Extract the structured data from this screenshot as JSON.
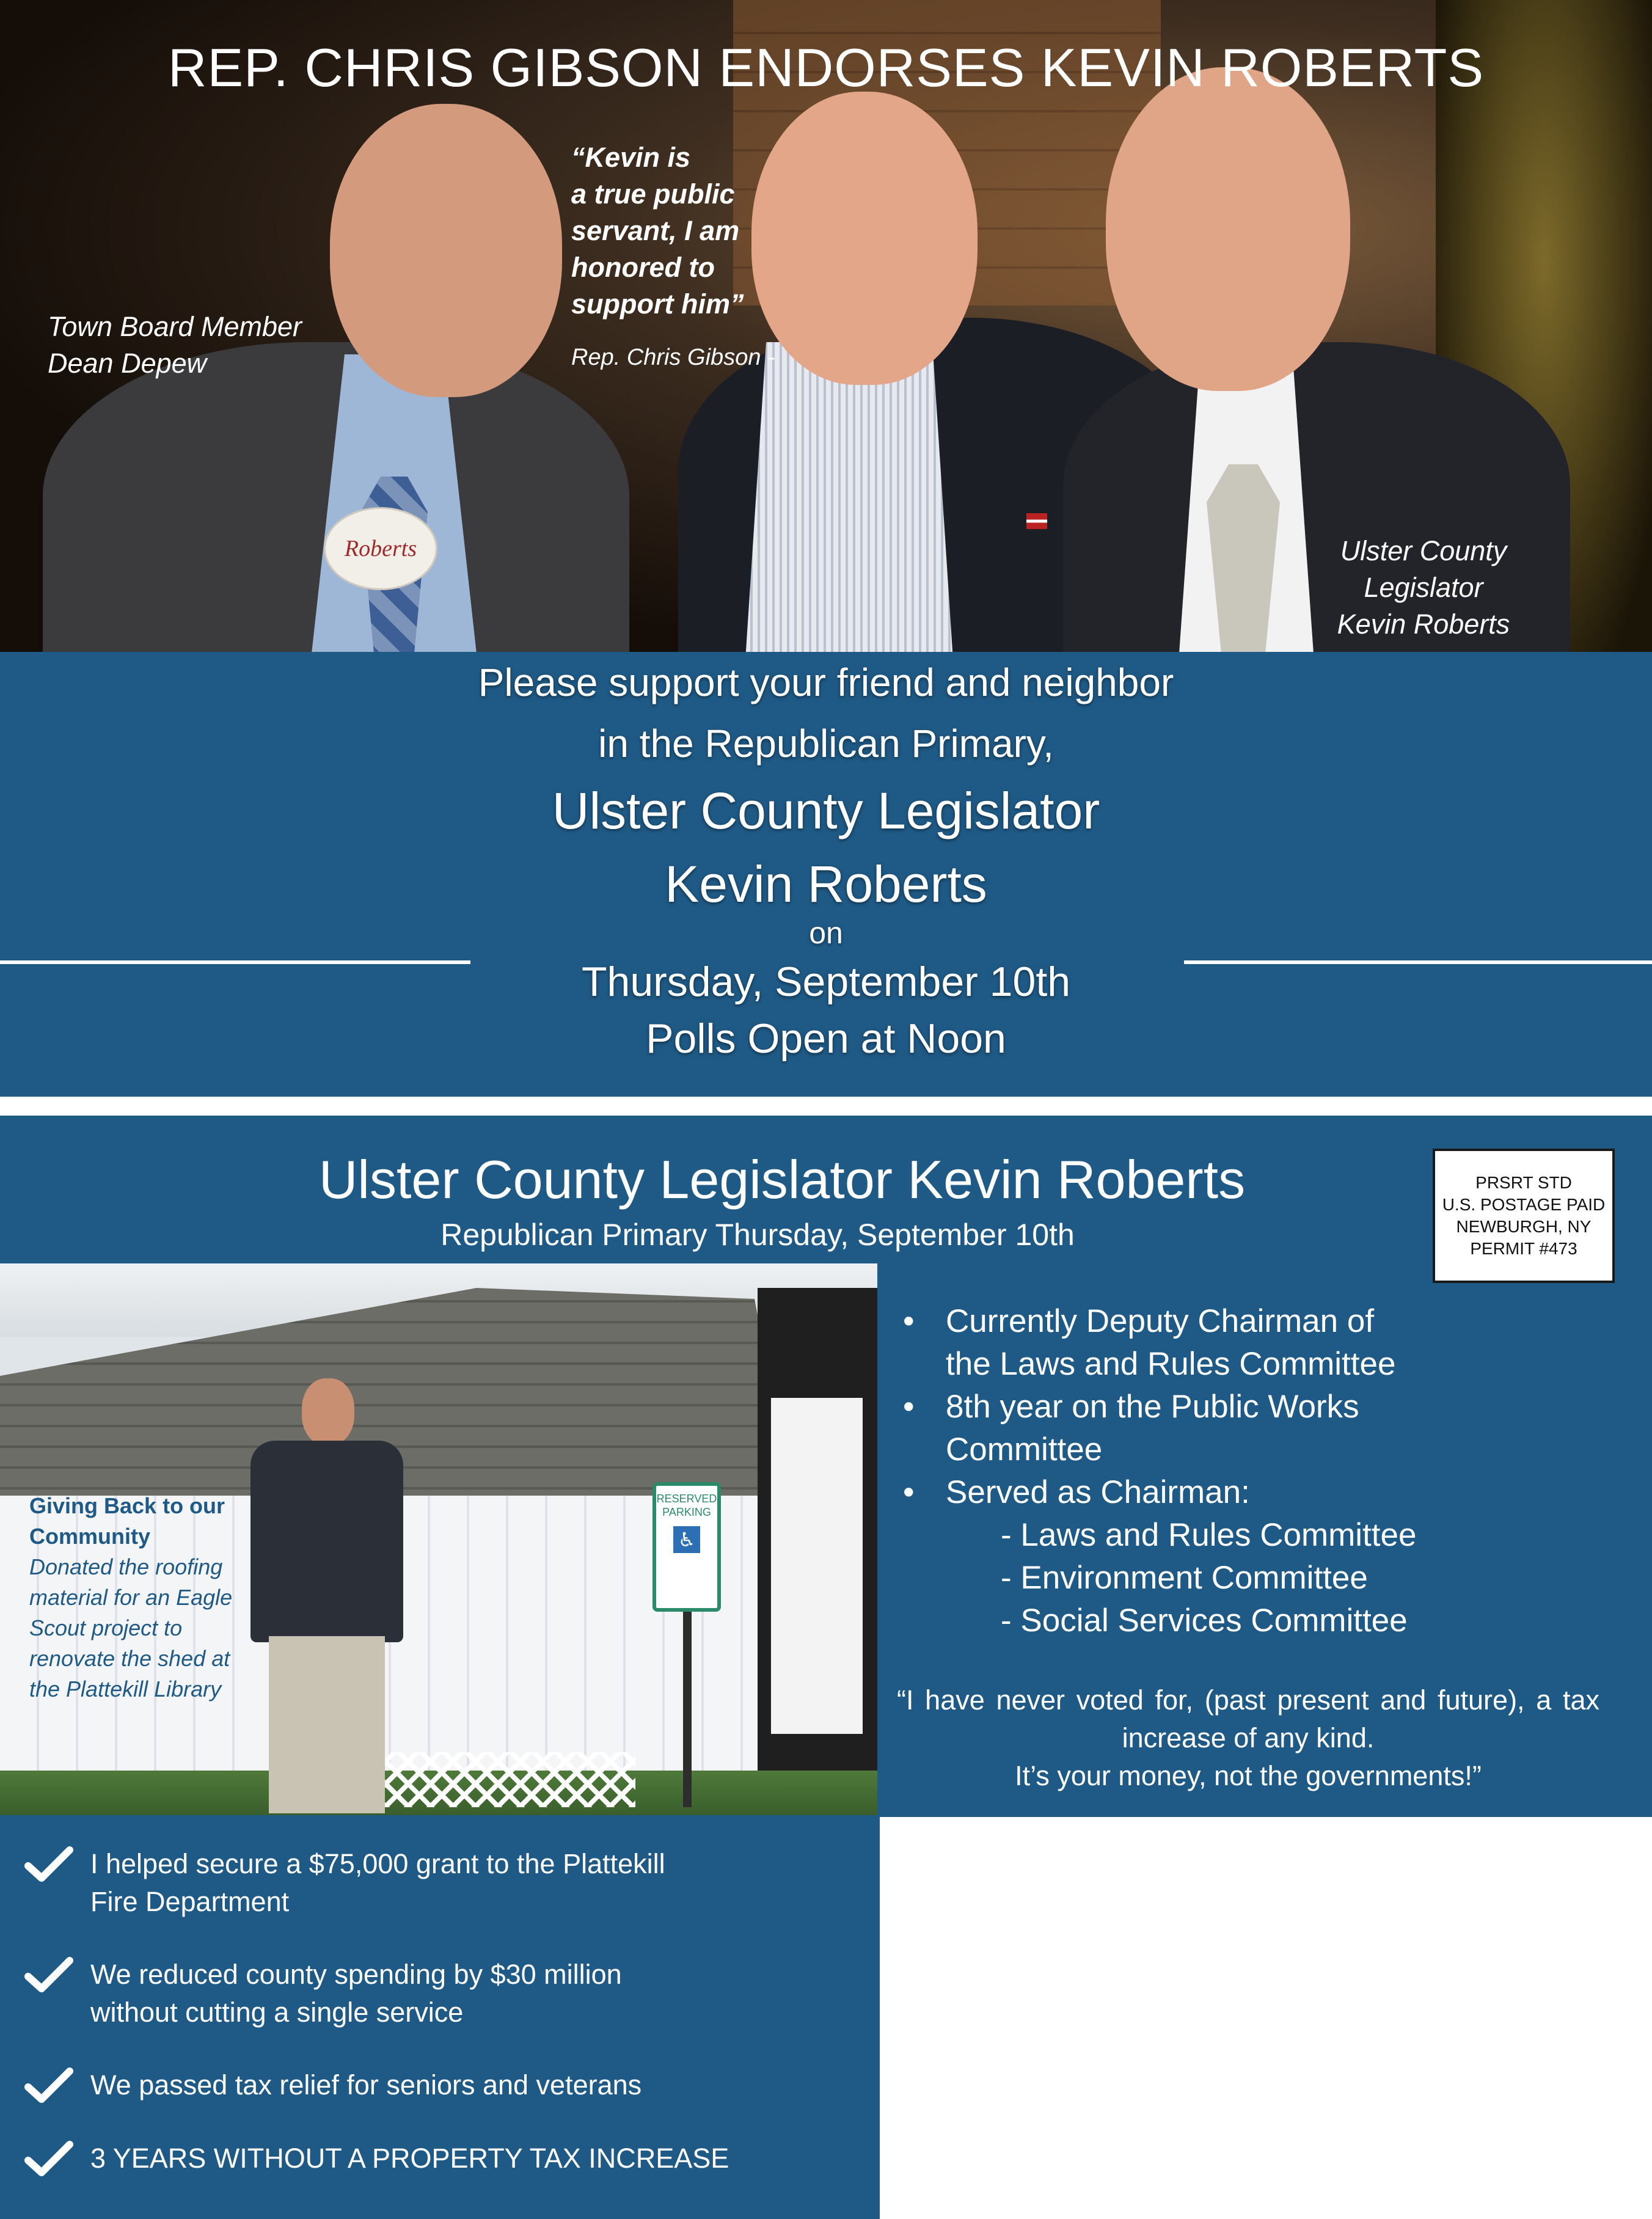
{
  "header": {
    "headline": "REP. CHRIS GIBSON ENDORSES KEVIN ROBERTS",
    "quote_lines": [
      "“Kevin is",
      "a true public",
      "servant, I am",
      "honored to",
      "support him”"
    ],
    "quote_attribution": "Rep. Chris Gibson -",
    "left_caption": [
      "Town Board Member",
      "Dean Depew"
    ],
    "right_caption": [
      "Ulster County",
      "Legislator",
      "Kevin Roberts"
    ],
    "button_text": "Roberts"
  },
  "appeal": {
    "line1": "Please support your friend and neighbor",
    "line2": "in the Republican Primary,",
    "line3": "Ulster County Legislator",
    "line4": "Kevin Roberts",
    "line5": "on",
    "line6": "Thursday, September 10th",
    "line7": "Polls Open at Noon"
  },
  "mailer": {
    "title": "Ulster County Legislator Kevin Roberts",
    "subtitle": "Republican Primary Thursday, September 10th",
    "postage": [
      "PRSRT STD",
      "U.S. POSTAGE PAID",
      "NEWBURGH, NY",
      "PERMIT #473"
    ]
  },
  "photo_caption": {
    "heading": [
      "Giving Back to our",
      "Community"
    ],
    "body": [
      "Donated the roofing",
      "material for an Eagle",
      "Scout project to",
      "renovate the shed at",
      "the Plattekill Library"
    ],
    "sign_text": [
      "RESERVED",
      "PARKING"
    ]
  },
  "record": {
    "bullets": [
      {
        "text": "Currently Deputy Chairman of",
        "cont": "the Laws and Rules Committee"
      },
      {
        "text": "8th year on the Public Works",
        "cont": "Committee"
      },
      {
        "text": "Served as Chairman:",
        "cont": ""
      }
    ],
    "chair_list": [
      "- Laws and Rules Committee",
      "- Environment Committee",
      "- Social Services Committee"
    ],
    "quote_line1": "“I have never voted for, (past present and future), a tax increase of any kind.",
    "quote_line2": "It’s your money, not the governments!”"
  },
  "achievements": [
    {
      "line1": "I helped secure a $75,000 grant to the Plattekill",
      "line2": "Fire Department"
    },
    {
      "line1": "We reduced county spending by $30 million",
      "line2": "without cutting a single service"
    },
    {
      "line1": "We passed tax relief for seniors and veterans",
      "line2": ""
    },
    {
      "line1": "3 YEARS WITHOUT A PROPERTY TAX INCREASE",
      "line2": ""
    }
  ],
  "colors": {
    "band_blue": "#1f5a86",
    "caption_blue": "#1f5a86"
  },
  "icons": [
    "check-icon"
  ]
}
